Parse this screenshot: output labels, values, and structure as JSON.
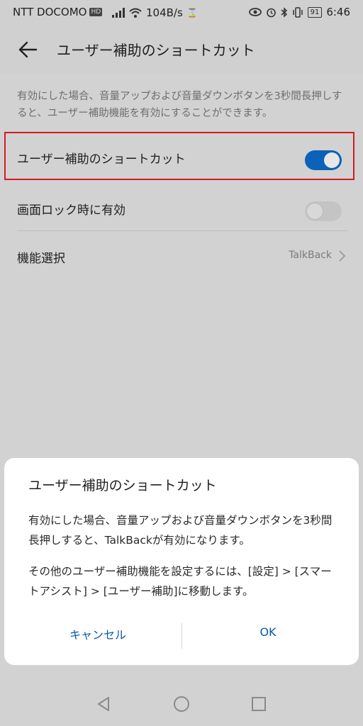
{
  "status_bar": {
    "carrier": "NTT DOCOMO",
    "hd_badge": "HD",
    "network_speed": "104B/s",
    "battery": "91",
    "time": "6:46"
  },
  "app_bar": {
    "title": "ユーザー補助のショートカット"
  },
  "description": "有効にした場合、音量アップおよび音量ダウンボタンを3秒間長押しすると、ユーザー補助機能を有効にすることができます。",
  "settings": {
    "shortcut": {
      "label": "ユーザー補助のショートカット",
      "enabled": true
    },
    "lock_screen": {
      "label": "画面ロック時に有効",
      "enabled": false
    },
    "feature": {
      "label": "機能選択",
      "value": "TalkBack"
    }
  },
  "dialog": {
    "title": "ユーザー補助のショートカット",
    "paragraph1": "有効にした場合、音量アップおよび音量ダウンボタンを3秒間長押しすると、TalkBackが有効になります。",
    "paragraph2": "その他のユーザー補助機能を設定するには、[設定] > [スマートアシスト] > [ユーザー補助]に移動します。",
    "cancel_label": "キャンセル",
    "ok_label": "OK"
  },
  "colors": {
    "accent": "#0b62b8",
    "highlight_border": "#d31c24"
  }
}
